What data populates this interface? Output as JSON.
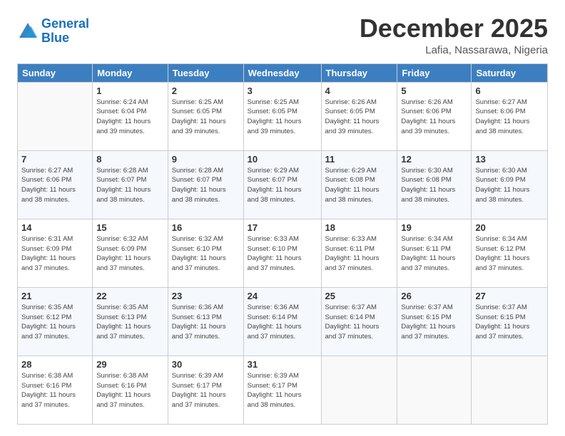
{
  "header": {
    "logo_line1": "General",
    "logo_line2": "Blue",
    "title": "December 2025",
    "subtitle": "Lafia, Nassarawa, Nigeria"
  },
  "columns": [
    "Sunday",
    "Monday",
    "Tuesday",
    "Wednesday",
    "Thursday",
    "Friday",
    "Saturday"
  ],
  "weeks": [
    [
      {
        "day": "",
        "info": ""
      },
      {
        "day": "1",
        "info": "Sunrise: 6:24 AM\nSunset: 6:04 PM\nDaylight: 11 hours\nand 39 minutes."
      },
      {
        "day": "2",
        "info": "Sunrise: 6:25 AM\nSunset: 6:05 PM\nDaylight: 11 hours\nand 39 minutes."
      },
      {
        "day": "3",
        "info": "Sunrise: 6:25 AM\nSunset: 6:05 PM\nDaylight: 11 hours\nand 39 minutes."
      },
      {
        "day": "4",
        "info": "Sunrise: 6:26 AM\nSunset: 6:05 PM\nDaylight: 11 hours\nand 39 minutes."
      },
      {
        "day": "5",
        "info": "Sunrise: 6:26 AM\nSunset: 6:06 PM\nDaylight: 11 hours\nand 39 minutes."
      },
      {
        "day": "6",
        "info": "Sunrise: 6:27 AM\nSunset: 6:06 PM\nDaylight: 11 hours\nand 38 minutes."
      }
    ],
    [
      {
        "day": "7",
        "info": "Sunrise: 6:27 AM\nSunset: 6:06 PM\nDaylight: 11 hours\nand 38 minutes."
      },
      {
        "day": "8",
        "info": "Sunrise: 6:28 AM\nSunset: 6:07 PM\nDaylight: 11 hours\nand 38 minutes."
      },
      {
        "day": "9",
        "info": "Sunrise: 6:28 AM\nSunset: 6:07 PM\nDaylight: 11 hours\nand 38 minutes."
      },
      {
        "day": "10",
        "info": "Sunrise: 6:29 AM\nSunset: 6:07 PM\nDaylight: 11 hours\nand 38 minutes."
      },
      {
        "day": "11",
        "info": "Sunrise: 6:29 AM\nSunset: 6:08 PM\nDaylight: 11 hours\nand 38 minutes."
      },
      {
        "day": "12",
        "info": "Sunrise: 6:30 AM\nSunset: 6:08 PM\nDaylight: 11 hours\nand 38 minutes."
      },
      {
        "day": "13",
        "info": "Sunrise: 6:30 AM\nSunset: 6:09 PM\nDaylight: 11 hours\nand 38 minutes."
      }
    ],
    [
      {
        "day": "14",
        "info": "Sunrise: 6:31 AM\nSunset: 6:09 PM\nDaylight: 11 hours\nand 37 minutes."
      },
      {
        "day": "15",
        "info": "Sunrise: 6:32 AM\nSunset: 6:09 PM\nDaylight: 11 hours\nand 37 minutes."
      },
      {
        "day": "16",
        "info": "Sunrise: 6:32 AM\nSunset: 6:10 PM\nDaylight: 11 hours\nand 37 minutes."
      },
      {
        "day": "17",
        "info": "Sunrise: 6:33 AM\nSunset: 6:10 PM\nDaylight: 11 hours\nand 37 minutes."
      },
      {
        "day": "18",
        "info": "Sunrise: 6:33 AM\nSunset: 6:11 PM\nDaylight: 11 hours\nand 37 minutes."
      },
      {
        "day": "19",
        "info": "Sunrise: 6:34 AM\nSunset: 6:11 PM\nDaylight: 11 hours\nand 37 minutes."
      },
      {
        "day": "20",
        "info": "Sunrise: 6:34 AM\nSunset: 6:12 PM\nDaylight: 11 hours\nand 37 minutes."
      }
    ],
    [
      {
        "day": "21",
        "info": "Sunrise: 6:35 AM\nSunset: 6:12 PM\nDaylight: 11 hours\nand 37 minutes."
      },
      {
        "day": "22",
        "info": "Sunrise: 6:35 AM\nSunset: 6:13 PM\nDaylight: 11 hours\nand 37 minutes."
      },
      {
        "day": "23",
        "info": "Sunrise: 6:36 AM\nSunset: 6:13 PM\nDaylight: 11 hours\nand 37 minutes."
      },
      {
        "day": "24",
        "info": "Sunrise: 6:36 AM\nSunset: 6:14 PM\nDaylight: 11 hours\nand 37 minutes."
      },
      {
        "day": "25",
        "info": "Sunrise: 6:37 AM\nSunset: 6:14 PM\nDaylight: 11 hours\nand 37 minutes."
      },
      {
        "day": "26",
        "info": "Sunrise: 6:37 AM\nSunset: 6:15 PM\nDaylight: 11 hours\nand 37 minutes."
      },
      {
        "day": "27",
        "info": "Sunrise: 6:37 AM\nSunset: 6:15 PM\nDaylight: 11 hours\nand 37 minutes."
      }
    ],
    [
      {
        "day": "28",
        "info": "Sunrise: 6:38 AM\nSunset: 6:16 PM\nDaylight: 11 hours\nand 37 minutes."
      },
      {
        "day": "29",
        "info": "Sunrise: 6:38 AM\nSunset: 6:16 PM\nDaylight: 11 hours\nand 37 minutes."
      },
      {
        "day": "30",
        "info": "Sunrise: 6:39 AM\nSunset: 6:17 PM\nDaylight: 11 hours\nand 37 minutes."
      },
      {
        "day": "31",
        "info": "Sunrise: 6:39 AM\nSunset: 6:17 PM\nDaylight: 11 hours\nand 38 minutes."
      },
      {
        "day": "",
        "info": ""
      },
      {
        "day": "",
        "info": ""
      },
      {
        "day": "",
        "info": ""
      }
    ]
  ]
}
